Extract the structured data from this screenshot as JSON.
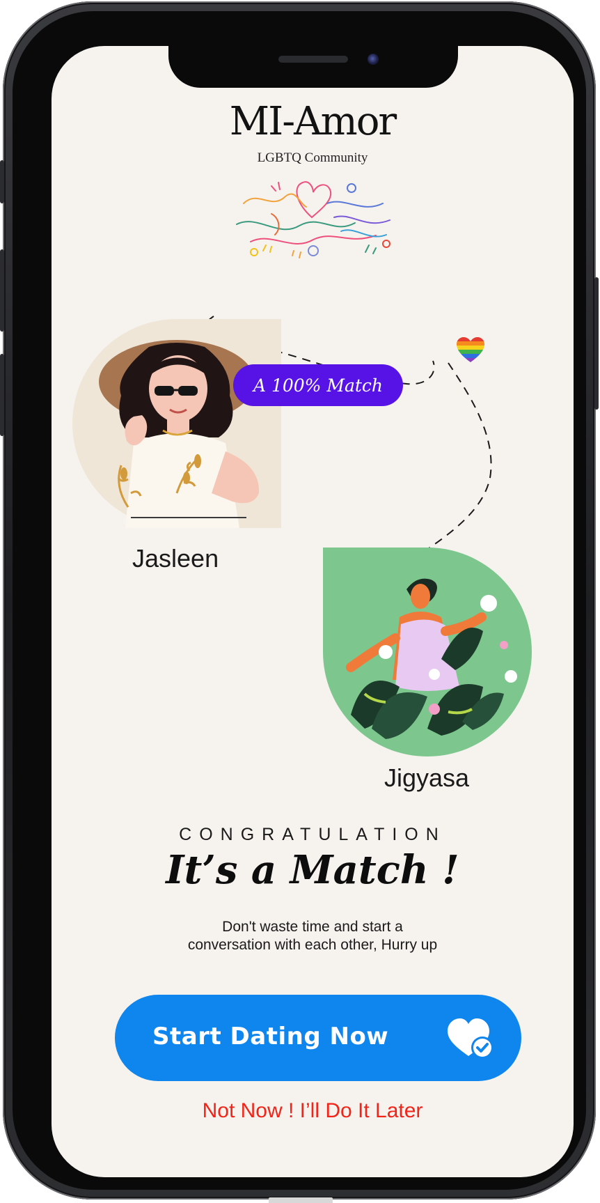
{
  "app": {
    "title": "MI-Amor",
    "subtitle": "LGBTQ Community"
  },
  "match": {
    "badge": "A 100% Match",
    "user_a": {
      "name": "Jasleen",
      "avatar": "woman-in-sun-hat-illustration"
    },
    "user_b": {
      "name": "Jigyasa",
      "avatar": "woman-in-garden-illustration"
    },
    "connector_icon": "rainbow-heart-icon"
  },
  "message": {
    "kicker": "CONGRATULATION",
    "headline": "It’s a Match !",
    "body_line1": "Don't waste time and start a",
    "body_line2": "conversation with each other, Hurry up"
  },
  "actions": {
    "primary_label": "Start Dating Now",
    "primary_icon": "heart-check-icon",
    "secondary_label": "Not Now ! I’ll Do It Later"
  },
  "colors": {
    "screen_bg": "#f6f3ef",
    "badge": "#5713e6",
    "primary_button": "#0f85ee",
    "secondary_link": "#f22418"
  }
}
